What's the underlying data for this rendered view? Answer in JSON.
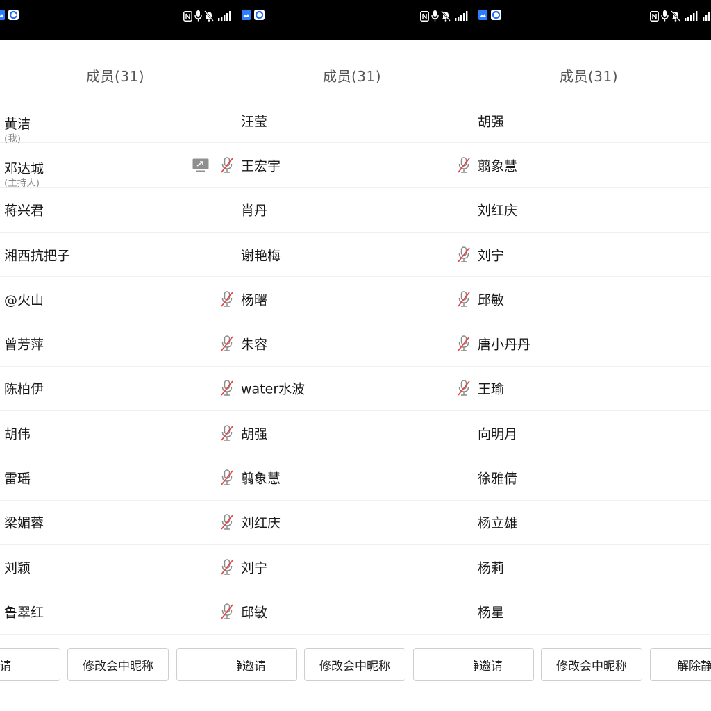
{
  "colors": {
    "statusbar_bg": "#000000",
    "muted_mic": "#e04848",
    "mic_gray": "#8a8a8a",
    "text_primary": "#1a1a1a",
    "text_secondary": "#888888",
    "divider": "#f0f0f0"
  },
  "panels": [
    {
      "title": "成员(31)",
      "members": [
        {
          "name": "黄洁",
          "sub": "(我)",
          "muted": false,
          "sharing": false
        },
        {
          "name": "邓达城",
          "sub": "(主持人)",
          "muted": true,
          "sharing": true
        },
        {
          "name": "蒋兴君",
          "sub": "",
          "muted": false,
          "sharing": false
        },
        {
          "name": "湘西抗把子",
          "sub": "",
          "muted": false,
          "sharing": false
        },
        {
          "name": "@火山",
          "sub": "",
          "muted": true,
          "sharing": false
        },
        {
          "name": "曾芳萍",
          "sub": "",
          "muted": true,
          "sharing": false
        },
        {
          "name": "陈柏伊",
          "sub": "",
          "muted": true,
          "sharing": false
        },
        {
          "name": "胡伟",
          "sub": "",
          "muted": true,
          "sharing": false
        },
        {
          "name": "雷瑶",
          "sub": "",
          "muted": true,
          "sharing": false
        },
        {
          "name": "梁媚蓉",
          "sub": "",
          "muted": true,
          "sharing": false
        },
        {
          "name": "刘颖",
          "sub": "",
          "muted": true,
          "sharing": false
        },
        {
          "name": "鲁翠红",
          "sub": "",
          "muted": true,
          "sharing": false
        }
      ],
      "buttons": [
        "邀请",
        "修改会中昵称"
      ]
    },
    {
      "title": "成员(31)",
      "members": [
        {
          "name": "汪莹",
          "sub": "",
          "muted": false,
          "sharing": false
        },
        {
          "name": "王宏宇",
          "sub": "",
          "muted": true,
          "sharing": false
        },
        {
          "name": "肖丹",
          "sub": "",
          "muted": false,
          "sharing": false
        },
        {
          "name": "谢艳梅",
          "sub": "",
          "muted": true,
          "sharing": false
        },
        {
          "name": "杨曙",
          "sub": "",
          "muted": true,
          "sharing": false
        },
        {
          "name": "朱容",
          "sub": "",
          "muted": true,
          "sharing": false
        },
        {
          "name": "water水波",
          "sub": "",
          "muted": true,
          "sharing": false
        },
        {
          "name": "胡强",
          "sub": "",
          "muted": false,
          "sharing": false
        },
        {
          "name": "翦象慧",
          "sub": "",
          "muted": false,
          "sharing": false
        },
        {
          "name": "刘红庆",
          "sub": "",
          "muted": false,
          "sharing": false
        },
        {
          "name": "刘宁",
          "sub": "",
          "muted": false,
          "sharing": false
        },
        {
          "name": "邱敏",
          "sub": "",
          "muted": false,
          "sharing": false
        }
      ],
      "buttons": [
        "解除静邀请",
        "修改会中昵称"
      ]
    },
    {
      "title": "成员(31)",
      "members": [
        {
          "name": "胡强",
          "sub": "",
          "muted": false,
          "sharing": false
        },
        {
          "name": "翦象慧",
          "sub": "",
          "muted": false,
          "sharing": false
        },
        {
          "name": "刘红庆",
          "sub": "",
          "muted": false,
          "sharing": false
        },
        {
          "name": "刘宁",
          "sub": "",
          "muted": false,
          "sharing": false
        },
        {
          "name": "邱敏",
          "sub": "",
          "muted": false,
          "sharing": false
        },
        {
          "name": "唐小丹丹",
          "sub": "",
          "muted": false,
          "sharing": false
        },
        {
          "name": "王瑜",
          "sub": "",
          "muted": false,
          "sharing": false
        },
        {
          "name": "向明月",
          "sub": "",
          "muted": false,
          "sharing": false
        },
        {
          "name": "徐雅倩",
          "sub": "",
          "muted": false,
          "sharing": false
        },
        {
          "name": "杨立雄",
          "sub": "",
          "muted": false,
          "sharing": false
        },
        {
          "name": "杨莉",
          "sub": "",
          "muted": false,
          "sharing": false
        },
        {
          "name": "杨星",
          "sub": "",
          "muted": false,
          "sharing": false
        }
      ],
      "buttons": [
        "解除静邀请",
        "修改会中昵称",
        "解除静"
      ]
    }
  ]
}
